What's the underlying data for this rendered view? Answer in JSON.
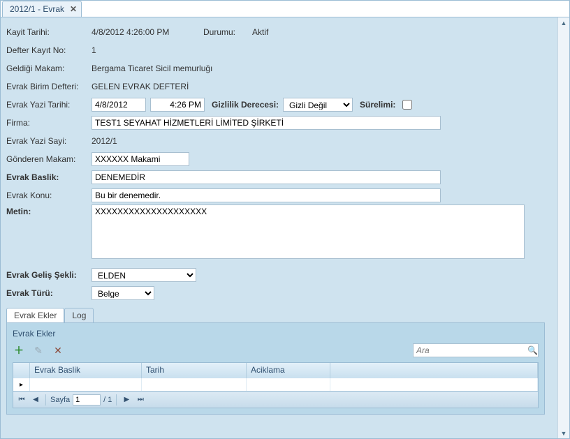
{
  "tab": {
    "title": "2012/1 - Evrak"
  },
  "header": {
    "kayit_tarihi_label": "Kayit Tarihi:",
    "kayit_tarihi_value": "4/8/2012 4:26:00 PM",
    "durumu_label": "Durumu:",
    "durumu_value": "Aktif",
    "defter_no_label": "Defter Kayıt No:",
    "defter_no_value": "1",
    "geldi_label": "Geldiği Makam:",
    "geldi_value": "Bergama Ticaret Sicil memurluğı",
    "birim_label": "Evrak Birim Defteri:",
    "birim_value": "GELEN EVRAK DEFTERİ",
    "yazi_tarihi_label": "Evrak Yazi Tarihi:",
    "yazi_date": "4/8/2012",
    "yazi_time": "4:26 PM",
    "gizlilik_label": "Gizlilik Derecesi:",
    "gizlilik_value": "Gizli Değil",
    "surelimi_label": "Sürelimi:",
    "firma_label": "Firma:",
    "firma_value": "TEST1 SEYAHAT HİZMETLERİ LİMİTED ŞİRKETİ",
    "sayi_label": "Evrak Yazi Sayi:",
    "sayi_value": "2012/1",
    "gonderen_label": "Gönderen Makam:",
    "gonderen_value": "XXXXXX Makami",
    "baslik_label": "Evrak Baslik:",
    "baslik_value": "DENEMEDİR",
    "konu_label": "Evrak Konu:",
    "konu_value": "Bu bir denemedir.",
    "metin_label": "Metin:",
    "metin_value": "XXXXXXXXXXXXXXXXXXXX",
    "gelis_label": "Evrak Geliş Şekli:",
    "gelis_value": "ELDEN",
    "turu_label": "Evrak Türü:",
    "turu_value": "Belge"
  },
  "subtabs": {
    "ekler": "Evrak Ekler",
    "log": "Log"
  },
  "pane": {
    "title": "Evrak Ekler",
    "search_placeholder": "Ara",
    "columns": {
      "baslik": "Evrak Baslik",
      "tarih": "Tarih",
      "aciklama": "Aciklama"
    },
    "pager": {
      "sayfa": "Sayfa",
      "num": "1",
      "of": "/ 1"
    }
  },
  "icons": {
    "add_color": "#2e8b2e",
    "delete_color": "#8b4a3a"
  }
}
